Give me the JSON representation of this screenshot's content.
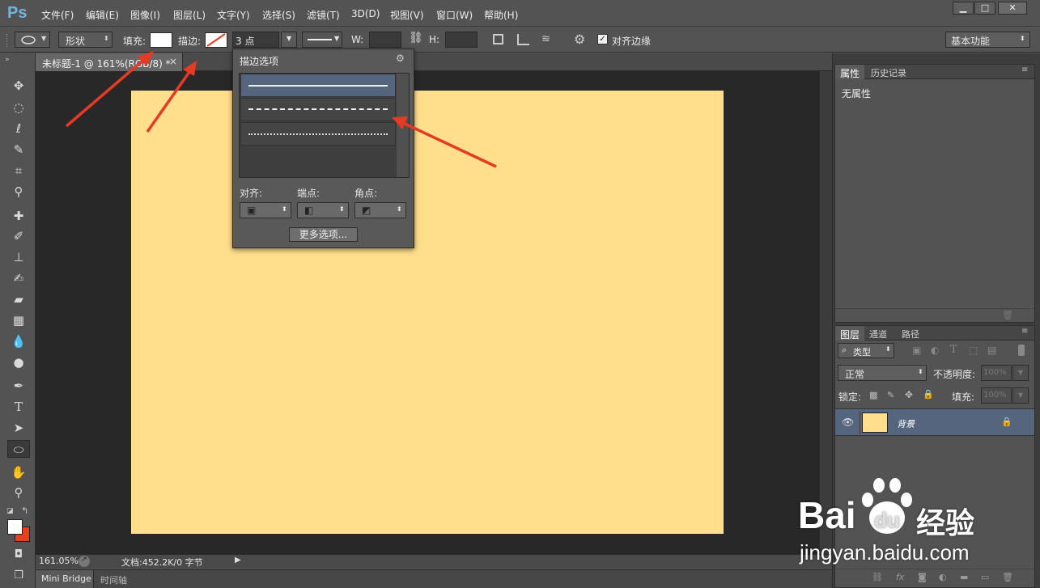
{
  "app": {
    "logo": "Ps"
  },
  "menus": [
    "文件(F)",
    "编辑(E)",
    "图像(I)",
    "图层(L)",
    "文字(Y)",
    "选择(S)",
    "滤镜(T)",
    "3D(D)",
    "视图(V)",
    "窗口(W)",
    "帮助(H)"
  ],
  "options": {
    "mode": "形状",
    "fill_label": "填充:",
    "stroke_label": "描边:",
    "stroke_width": "3 点",
    "w_label": "W:",
    "h_label": "H:",
    "align_edges": "对齐边缘",
    "workspace": "基本功能"
  },
  "document": {
    "tab_title": "未标题-1 @ 161%(RGB/8) *",
    "close": "×"
  },
  "stroke_popup": {
    "title": "描边选项",
    "align_label": "对齐:",
    "caps_label": "端点:",
    "corners_label": "角点:",
    "more_button": "更多选项..."
  },
  "status": {
    "zoom": "161.05%",
    "doc": "文档:452.2K/0 字节"
  },
  "bottom_tabs": [
    "Mini Bridge",
    "时间轴"
  ],
  "properties_panel": {
    "tabs": [
      "属性",
      "历史记录"
    ],
    "content": "无属性"
  },
  "layers_panel": {
    "tabs": [
      "图层",
      "通道",
      "路径"
    ],
    "filter": "类型",
    "blend_mode": "正常",
    "opacity_label": "不透明度:",
    "opacity_value": "100%",
    "lock_label": "锁定:",
    "fill_label": "填充:",
    "fill_value": "100%",
    "layer_name": "背景"
  },
  "watermark": {
    "brand": "Bai",
    "brand2": "经验",
    "url": "jingyan.baidu.com"
  },
  "colors": {
    "canvas": "#ffdf8b",
    "accent_arrow": "#e53a24",
    "bg_swatch": "#e8401c"
  }
}
